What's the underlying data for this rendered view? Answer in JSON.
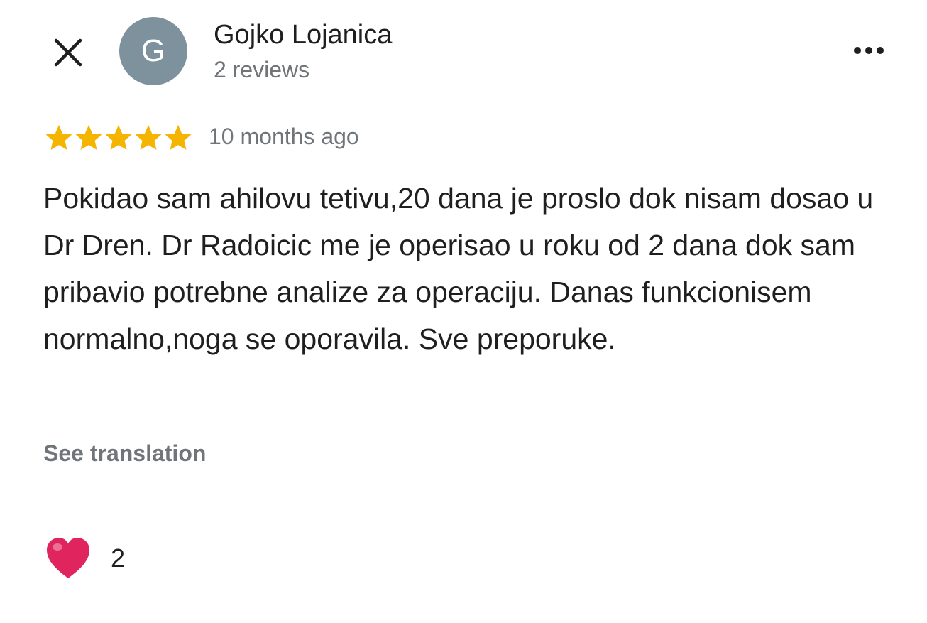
{
  "header": {
    "close_icon": "close-icon",
    "avatar_letter": "G",
    "avatar_color": "#7d929c",
    "reviewer_name": "Gojko Lojanica",
    "reviewer_meta": "2 reviews",
    "more_icon": "more-horizontal-icon"
  },
  "review": {
    "rating": 5,
    "rating_max": 5,
    "star_color": "#f4b400",
    "time": "10 months ago",
    "text": "Pokidao sam ahilovu tetivu,20 dana je proslo dok nisam dosao u Dr Dren. Dr Radoicic me je operisao u roku od 2 dana dok sam pribavio potrebne analize za operaciju. Danas funkcionisem normalno,noga se oporavila. Sve preporuke.",
    "see_translation": "See translation"
  },
  "reactions": {
    "icon": "heart-icon",
    "heart_color": "#e0245e",
    "count": "2"
  }
}
